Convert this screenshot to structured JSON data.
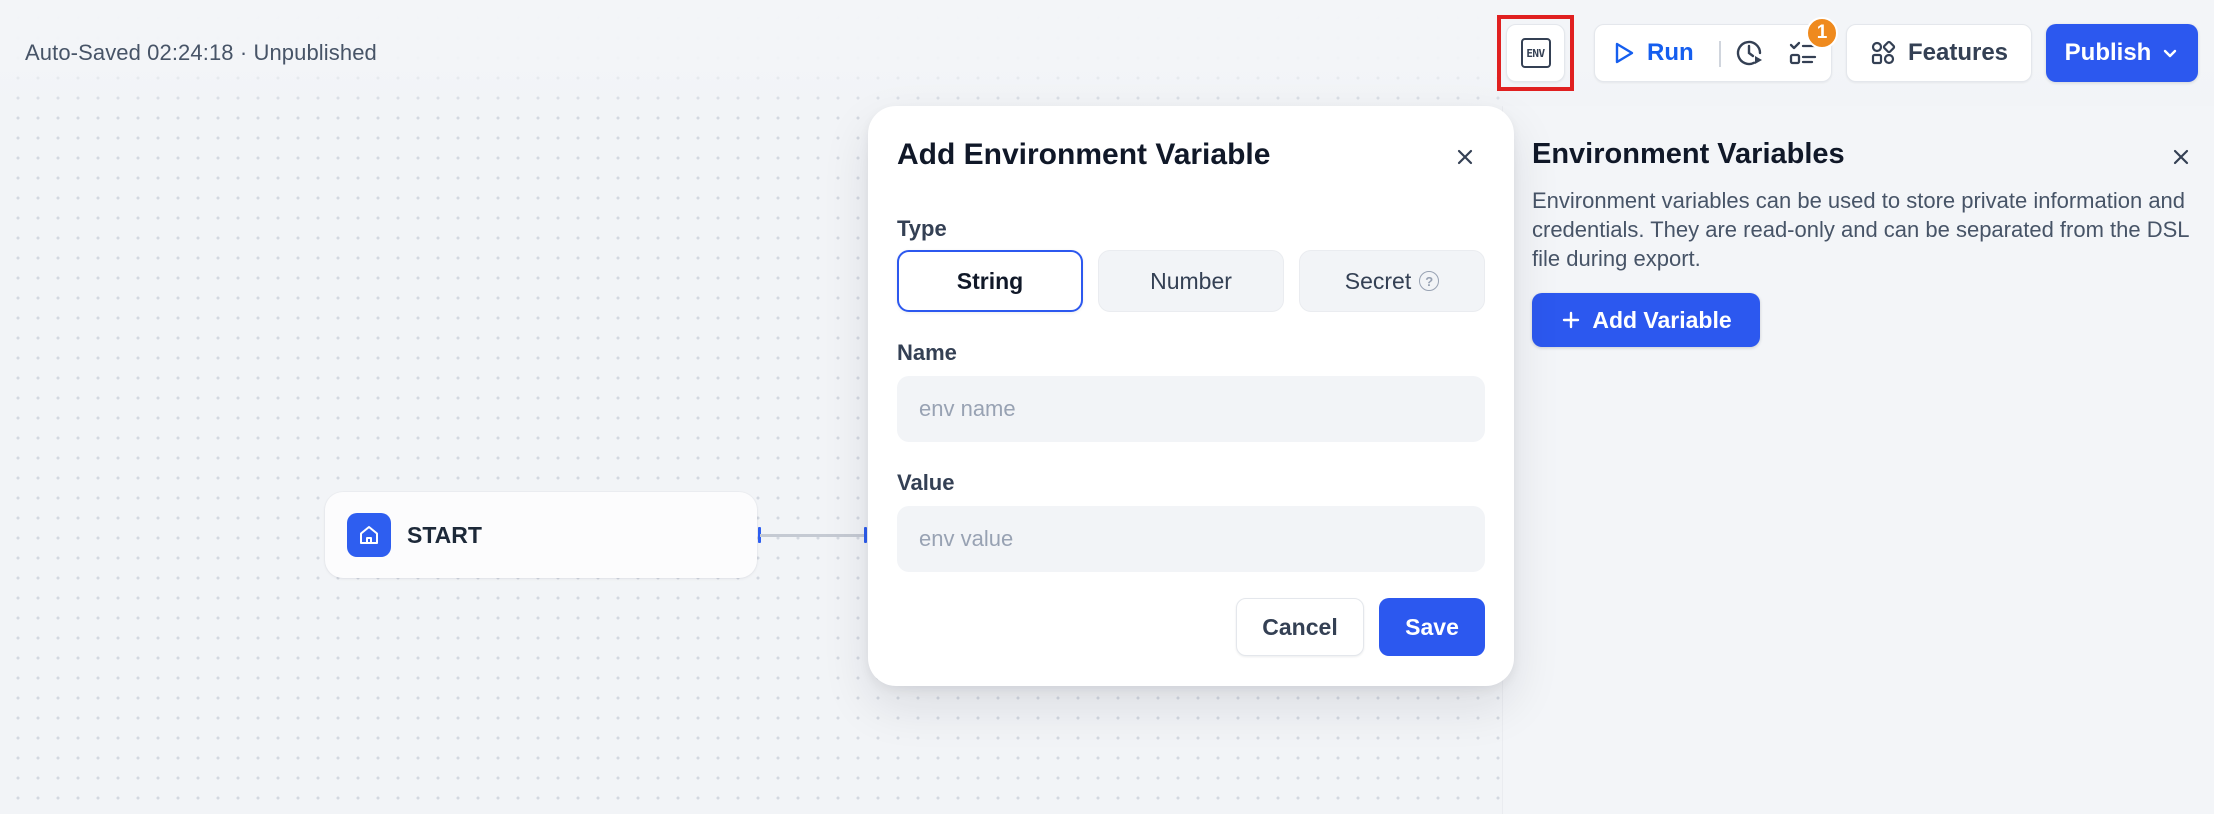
{
  "header": {
    "autosave_text": "Auto-Saved 02:24:18 · Unpublished",
    "env_button_icon": "ENV",
    "run_label": "Run",
    "checklist_badge": "1",
    "features_label": "Features",
    "publish_label": "Publish"
  },
  "canvas": {
    "start_node_label": "START"
  },
  "modal": {
    "title": "Add Environment Variable",
    "type_label": "Type",
    "type_options": [
      "String",
      "Number",
      "Secret"
    ],
    "selected_type": "String",
    "name_label": "Name",
    "name_placeholder": "env name",
    "name_value": "",
    "value_label": "Value",
    "value_placeholder": "env value",
    "value_value": "",
    "cancel_label": "Cancel",
    "save_label": "Save"
  },
  "env_panel": {
    "title": "Environment Variables",
    "description": "Environment variables can be used to store private information and credentials. They are read-only and can be separated from the DSL file during export.",
    "add_button_label": "Add Variable"
  },
  "colors": {
    "primary": "#2c58ef",
    "badge": "#ef8a1e",
    "highlight": "#e02020"
  }
}
